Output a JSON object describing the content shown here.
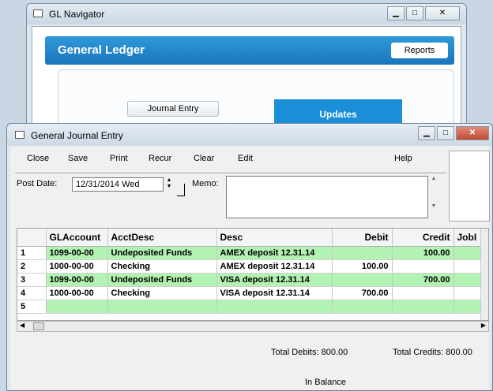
{
  "nav_window": {
    "title": "GL Navigator",
    "banner_title": "General Ledger",
    "reports_button": "Reports",
    "journal_entry_button": "Journal Entry",
    "updates_tab": "Updates"
  },
  "entry_window": {
    "title": "General Journal Entry",
    "menu": [
      "Close",
      "Save",
      "Print",
      "Recur",
      "Clear",
      "Edit",
      "Help"
    ],
    "post_date_label": "Post Date:",
    "post_date_value": "12/31/2014 Wed",
    "memo_label": "Memo:",
    "memo_value": "",
    "grid": {
      "columns": [
        "GLAccount",
        "AcctDesc",
        "Desc",
        "Debit",
        "Credit",
        "JobI"
      ],
      "rows": [
        {
          "num": "1",
          "account": "1099-00-00",
          "acct_desc": "Undeposited Funds",
          "desc": "AMEX deposit 12.31.14",
          "debit": "",
          "credit": "100.00"
        },
        {
          "num": "2",
          "account": "1000-00-00",
          "acct_desc": "Checking",
          "desc": "AMEX deposit 12.31.14",
          "debit": "100.00",
          "credit": ""
        },
        {
          "num": "3",
          "account": "1099-00-00",
          "acct_desc": "Undeposited Funds",
          "desc": "VISA deposit 12.31.14",
          "debit": "",
          "credit": "700.00"
        },
        {
          "num": "4",
          "account": "1000-00-00",
          "acct_desc": "Checking",
          "desc": "VISA deposit 12.31.14",
          "debit": "700.00",
          "credit": ""
        },
        {
          "num": "5",
          "account": "",
          "acct_desc": "",
          "desc": "",
          "debit": "",
          "credit": ""
        }
      ]
    },
    "total_debits": "Total Debits: 800.00",
    "total_credits": "Total Credits: 800.00",
    "balance_status": "In Balance"
  },
  "colors": {
    "accent_blue": "#1a8ed7",
    "row_highlight": "#b2f2b2"
  }
}
